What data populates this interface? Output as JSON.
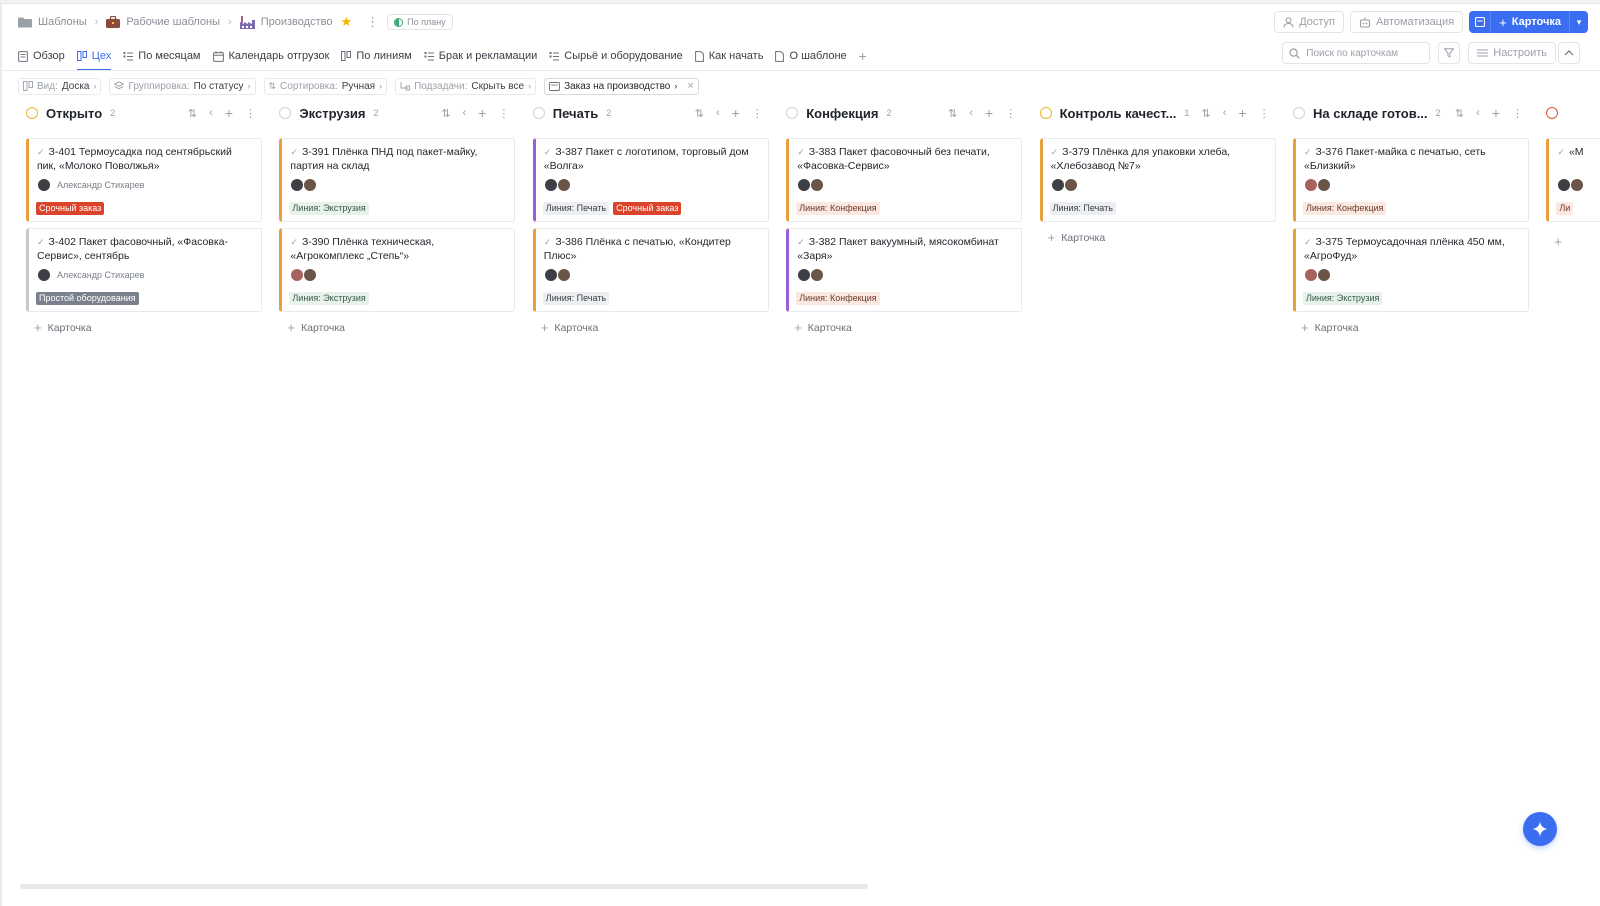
{
  "breadcrumbs": [
    {
      "label": "Шаблоны",
      "icon": "folder-icon"
    },
    {
      "label": "Рабочие шаблоны",
      "icon": "briefcase-icon"
    },
    {
      "label": "Производство",
      "icon": "factory-icon"
    }
  ],
  "status_pill": "По плану",
  "header_buttons": {
    "access": "Доступ",
    "automation": "Автоматизация",
    "new_card": "Карточка"
  },
  "tabs": [
    {
      "label": "Обзор",
      "icon": "doc-icon"
    },
    {
      "label": "Цех",
      "icon": "board-icon",
      "active": true
    },
    {
      "label": "По месяцам",
      "icon": "list-icon"
    },
    {
      "label": "Календарь отгрузок",
      "icon": "calendar-icon"
    },
    {
      "label": "По линиям",
      "icon": "board-icon"
    },
    {
      "label": "Брак и рекламации",
      "icon": "list-icon"
    },
    {
      "label": "Сырьё и оборудование",
      "icon": "list-icon"
    },
    {
      "label": "Как начать",
      "icon": "page-icon"
    },
    {
      "label": "О шаблоне",
      "icon": "page-icon"
    }
  ],
  "search": {
    "placeholder": "Поиск по карточкам"
  },
  "configure_label": "Настроить",
  "chips": {
    "view_key": "Вид:",
    "view_val": "Доска",
    "group_key": "Группировка:",
    "group_val": "По статусу",
    "sort_key": "Сортировка:",
    "sort_val": "Ручная",
    "sub_key": "Подзадачи:",
    "sub_val": "Скрыть все",
    "active_filter": "Заказ на производство"
  },
  "add_card_label": "Карточка",
  "columns": [
    {
      "title": "Открыто",
      "count": "2",
      "circle": "#f0b429",
      "cards": [
        {
          "title": "З-401 Термоусадка под сентябрьский пик, «Молоко Поволжья»",
          "person": "Александр Стихарев",
          "accent": "#e8a13a",
          "tags": [
            {
              "label": "Срочный заказ",
              "bg": "#d9442b",
              "fg": "#ffffff"
            }
          ]
        },
        {
          "title": "З-402 Пакет фасовочный, «Фасовка-Сервис», сентябрь",
          "person": "Александр Стихарев",
          "accent": "#c5c8ce",
          "tags": [
            {
              "label": "Простой оборудования",
              "bg": "#7b818c",
              "fg": "#ffffff"
            }
          ]
        }
      ]
    },
    {
      "title": "Экструзия",
      "count": "2",
      "circle": "#d0d3d8",
      "cards": [
        {
          "title": "З-391 Плёнка ПНД под пакет-майку, партия на склад",
          "person": "",
          "accent": "#e8a13a",
          "tags": [
            {
              "label": "Линия: Экструзия",
              "bg": "#e6f2ea",
              "fg": "#3a5a47"
            }
          ]
        },
        {
          "title": "З-390 Плёнка техническая, «Агрокомплекс „Степь“»",
          "person": "",
          "accent": "#e8a13a",
          "tags": [
            {
              "label": "Линия: Экструзия",
              "bg": "#e6f2ea",
              "fg": "#3a5a47"
            }
          ]
        }
      ]
    },
    {
      "title": "Печать",
      "count": "2",
      "circle": "#d0d3d8",
      "cards": [
        {
          "title": "З-387 Пакет с логотипом, торговый дом «Волга»",
          "person": "",
          "accent": "#9b5fd1",
          "tags": [
            {
              "label": "Линия: Печать",
              "bg": "#eceef2",
              "fg": "#3a3f47"
            },
            {
              "label": "Срочный заказ",
              "bg": "#d9442b",
              "fg": "#ffffff"
            }
          ]
        },
        {
          "title": "З-386 Плёнка с печатью, «Кондитер Плюс»",
          "person": "",
          "accent": "#e8a13a",
          "tags": [
            {
              "label": "Линия: Печать",
              "bg": "#eceef2",
              "fg": "#3a3f47"
            }
          ]
        }
      ]
    },
    {
      "title": "Конфекция",
      "count": "2",
      "circle": "#d0d3d8",
      "cards": [
        {
          "title": "З-383 Пакет фасовочный без печати, «Фасовка-Сервис»",
          "person": "",
          "accent": "#e8a13a",
          "tags": [
            {
              "label": "Линия: Конфекция",
              "bg": "#fbe9e1",
              "fg": "#6a3a2a"
            }
          ]
        },
        {
          "title": "З-382 Пакет вакуумный, мясокомбинат «Заря»",
          "person": "",
          "accent": "#9b5fd1",
          "tags": [
            {
              "label": "Линия: Конфекция",
              "bg": "#fbe9e1",
              "fg": "#6a3a2a"
            }
          ]
        }
      ]
    },
    {
      "title": "Контроль качест...",
      "count": "1",
      "circle": "#f0b429",
      "cards": [
        {
          "title": "З-379 Плёнка для упаковки хлеба, «Хлебозавод №7»",
          "person": "",
          "accent": "#e8a13a",
          "tags": [
            {
              "label": "Линия: Печать",
              "bg": "#eceef2",
              "fg": "#3a3f47"
            }
          ]
        }
      ]
    },
    {
      "title": "На складе готов...",
      "count": "2",
      "circle": "#d0d3d8",
      "cards": [
        {
          "title": "З-376 Пакет-майка с печатью, сеть «Близкий»",
          "person": "",
          "accent": "#e8a13a",
          "tags": [
            {
              "label": "Линия: Конфекция",
              "bg": "#fbe9e1",
              "fg": "#6a3a2a"
            }
          ]
        },
        {
          "title": "З-375 Термоусадочная плёнка 450 мм, «АгроФуд»",
          "person": "",
          "accent": "#e8a13a",
          "tags": [
            {
              "label": "Линия: Экструзия",
              "bg": "#e6f2ea",
              "fg": "#3a5a47"
            }
          ]
        }
      ]
    },
    {
      "title": "",
      "count": "",
      "circle": "#e0552f",
      "cards": [
        {
          "title": "«М",
          "person": "",
          "accent": "#e8a13a",
          "tags": [
            {
              "label": "Ли",
              "bg": "#fbe9e1",
              "fg": "#6a3a2a"
            }
          ]
        }
      ]
    }
  ],
  "colors": {
    "accent": "#3b6df0",
    "urgent": "#d9442b"
  }
}
